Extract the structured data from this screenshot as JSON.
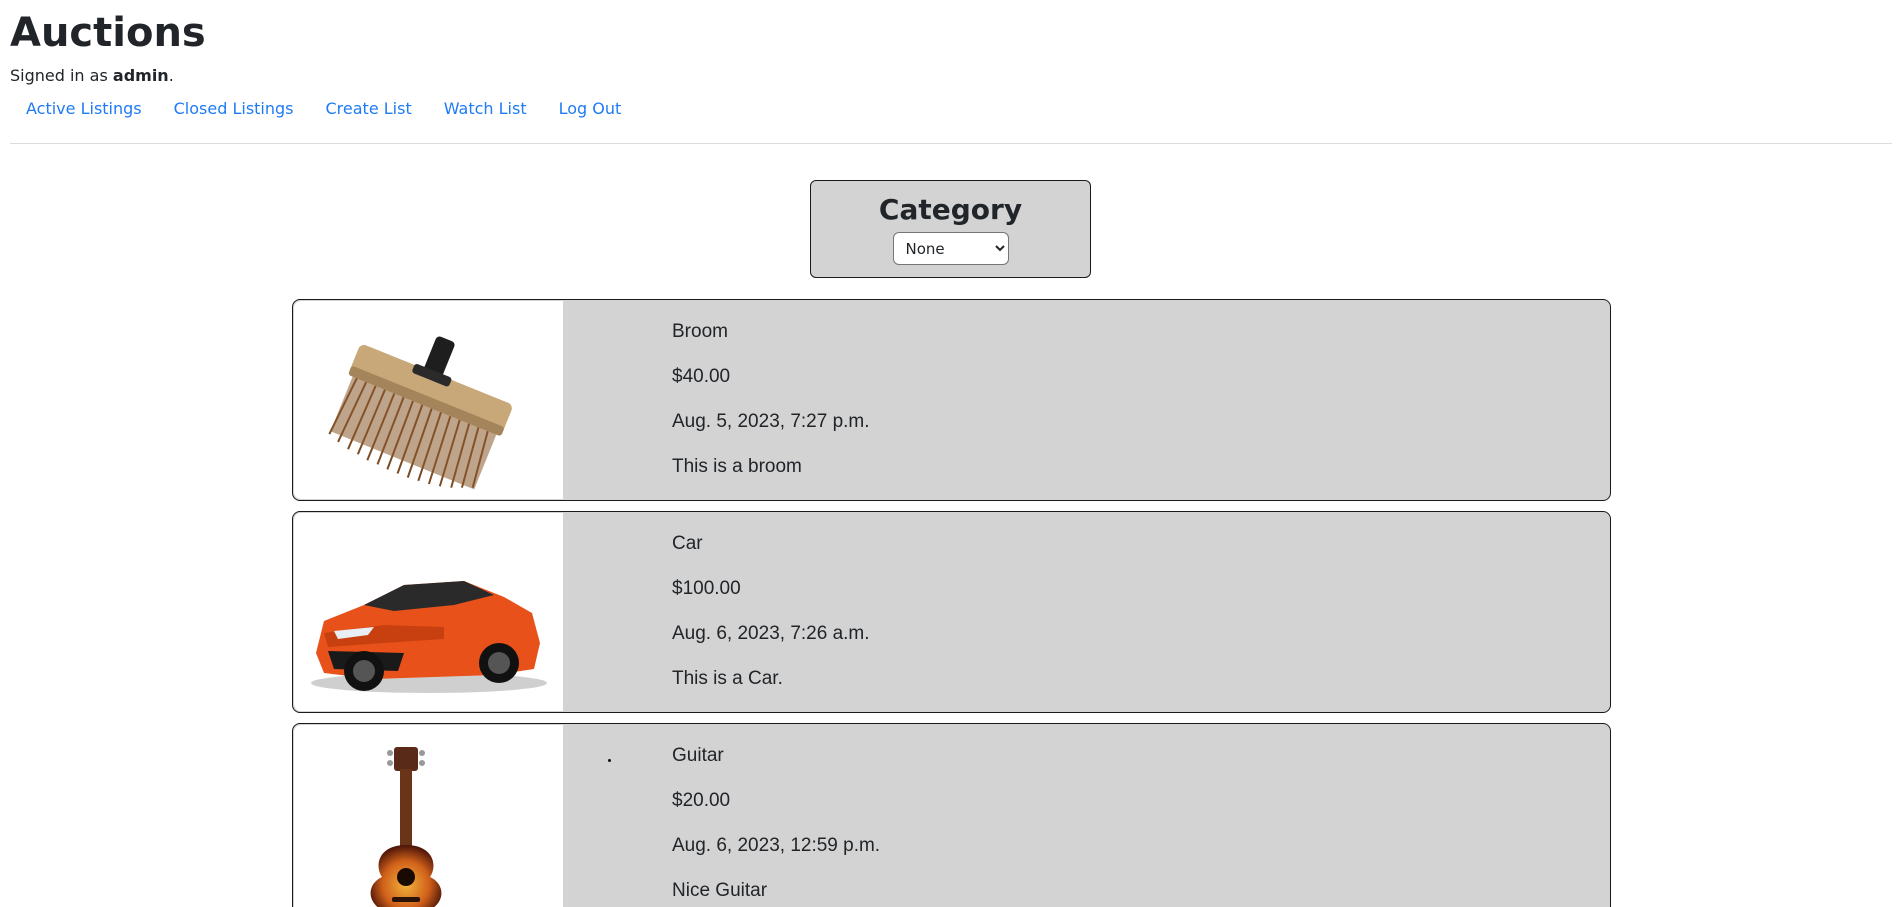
{
  "site": {
    "title": "Auctions",
    "signed_in_prefix": "Signed in as ",
    "username": "admin",
    "signed_in_suffix": "."
  },
  "nav": {
    "items": [
      {
        "label": "Active Listings"
      },
      {
        "label": "Closed Listings"
      },
      {
        "label": "Create List"
      },
      {
        "label": "Watch List"
      },
      {
        "label": "Log Out"
      }
    ],
    "link_color": "#1e7bf5"
  },
  "category_filter": {
    "title": "Category",
    "selected": "None",
    "options": [
      "None"
    ]
  },
  "listings": [
    {
      "title": "Broom",
      "price": "$40.00",
      "date": "Aug. 5, 2023, 7:27 p.m.",
      "description": "This is a broom",
      "image_icon": "broom-image"
    },
    {
      "title": "Car",
      "price": "$100.00",
      "date": "Aug. 6, 2023, 7:26 a.m.",
      "description": "This is a Car.",
      "image_icon": "car-image"
    },
    {
      "title": "Guitar",
      "price": "$20.00",
      "date": "Aug. 6, 2023, 12:59 p.m.",
      "description": "Nice Guitar",
      "image_icon": "guitar-image"
    }
  ],
  "colors": {
    "card_background": "#d3d3d3",
    "card_border": "#1a1a1a",
    "text": "#212529"
  }
}
